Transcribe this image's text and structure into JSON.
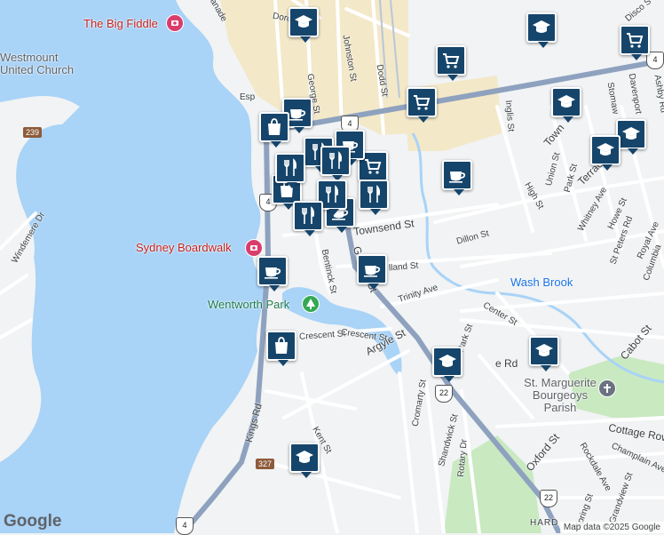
{
  "map": {
    "poi_labels": [
      {
        "id": "big-fiddle",
        "text": "The Big Fiddle"
      },
      {
        "id": "boardwalk",
        "text": "Sydney Boardwalk"
      }
    ],
    "place_labels": [
      {
        "id": "westmount-church",
        "text": "Westmount United Church"
      },
      {
        "id": "st-marguerite",
        "text": "St. Marguerite Bourgeoys Parish"
      }
    ],
    "area_labels": [
      {
        "id": "wentworth-park",
        "text": "Wentworth Park"
      }
    ],
    "water_labels": [
      {
        "id": "wash-brook",
        "text": "Wash Brook"
      }
    ],
    "street_labels": [
      {
        "id": "townsend",
        "text": "Townsend St"
      },
      {
        "id": "george-n",
        "text": "George St"
      },
      {
        "id": "johnston",
        "text": "Johnston St"
      },
      {
        "id": "dodd",
        "text": "Dodd St"
      },
      {
        "id": "bentinck",
        "text": "Bentinck St"
      },
      {
        "id": "george-s",
        "text": "George St"
      },
      {
        "id": "dillon",
        "text": "Dillon St"
      },
      {
        "id": "holland",
        "text": "lland St"
      },
      {
        "id": "trinity",
        "text": "Trinity Ave"
      },
      {
        "id": "crescent-1",
        "text": "Crescent St"
      },
      {
        "id": "crescent-2",
        "text": "Crescent St"
      },
      {
        "id": "argyle",
        "text": "Argyle St"
      },
      {
        "id": "kings",
        "text": "Kings Rd"
      },
      {
        "id": "kent",
        "text": "Kent St"
      },
      {
        "id": "center",
        "text": "Center St"
      },
      {
        "id": "park",
        "text": "Park St"
      },
      {
        "id": "cromarty",
        "text": "Cromarty St"
      },
      {
        "id": "shandwick",
        "text": "Shandwick St"
      },
      {
        "id": "rotary",
        "text": "Rotary Dr"
      },
      {
        "id": "oxford",
        "text": "Oxford St"
      },
      {
        "id": "rockdale",
        "text": "Rockdale Ave"
      },
      {
        "id": "spring",
        "text": "Spring St"
      },
      {
        "id": "grandview",
        "text": "Grandview St"
      },
      {
        "id": "cottage",
        "text": "Cottage Row"
      },
      {
        "id": "champlain",
        "text": "Champlain Ave"
      },
      {
        "id": "cabot",
        "text": "Cabot St"
      },
      {
        "id": "inglis",
        "text": "Inglis St"
      },
      {
        "id": "union",
        "text": "Union St"
      },
      {
        "id": "park2",
        "text": "Park St"
      },
      {
        "id": "high",
        "text": "High St"
      },
      {
        "id": "whitney",
        "text": "Whitney Ave"
      },
      {
        "id": "terrace",
        "text": "Terrace St"
      },
      {
        "id": "town",
        "text": "Town"
      },
      {
        "id": "howe",
        "text": "Howe St"
      },
      {
        "id": "st-peters",
        "text": "St Peters Rd"
      },
      {
        "id": "royal",
        "text": "Royal Ave"
      },
      {
        "id": "columbia",
        "text": "Columbia"
      },
      {
        "id": "stoma",
        "text": "Stomaw"
      },
      {
        "id": "davenport",
        "text": "Davenport"
      },
      {
        "id": "ashby",
        "text": "Ashby Rd"
      },
      {
        "id": "disco",
        "text": "Disco S"
      },
      {
        "id": "windemere",
        "text": "Windemere Dr"
      },
      {
        "id": "dorch",
        "text": "Dorch"
      },
      {
        "id": "anade",
        "text": "anade"
      },
      {
        "id": "esp",
        "text": "Esp"
      },
      {
        "id": "rd-frag",
        "text": "e Rd"
      },
      {
        "id": "hard",
        "text": "HARD"
      }
    ],
    "shields": [
      {
        "id": "r239",
        "text": "239"
      },
      {
        "id": "r327",
        "text": "327"
      },
      {
        "id": "h4-top",
        "text": "4"
      },
      {
        "id": "h4-mid",
        "text": "4"
      },
      {
        "id": "h4-bottom",
        "text": "4"
      },
      {
        "id": "h4-ne",
        "text": "4"
      },
      {
        "id": "h22-a",
        "text": "22"
      },
      {
        "id": "h22-b",
        "text": "22"
      }
    ],
    "markers": [
      {
        "type": "school"
      },
      {
        "type": "school"
      },
      {
        "type": "school"
      },
      {
        "type": "school"
      },
      {
        "type": "school"
      },
      {
        "type": "school"
      },
      {
        "type": "school"
      },
      {
        "type": "school"
      },
      {
        "type": "cart"
      },
      {
        "type": "cart"
      },
      {
        "type": "cart"
      },
      {
        "type": "cart"
      },
      {
        "type": "coffee"
      },
      {
        "type": "coffee"
      },
      {
        "type": "coffee"
      },
      {
        "type": "coffee"
      },
      {
        "type": "coffee"
      },
      {
        "type": "coffee"
      },
      {
        "type": "shopping-bag"
      },
      {
        "type": "shopping-bag"
      },
      {
        "type": "shopping-bag"
      },
      {
        "type": "restaurant"
      },
      {
        "type": "restaurant"
      },
      {
        "type": "restaurant"
      },
      {
        "type": "restaurant"
      },
      {
        "type": "restaurant"
      },
      {
        "type": "restaurant"
      }
    ],
    "colors": {
      "water": "#a9d3f7",
      "land": "#f1f3f4",
      "park": "#c9e9c1",
      "urban": "#f3e8c8",
      "highway": "#8ea2bf",
      "marker": "#16456b"
    }
  },
  "footer": {
    "logo": "Google",
    "attribution": "Map data ©2025 Google"
  }
}
